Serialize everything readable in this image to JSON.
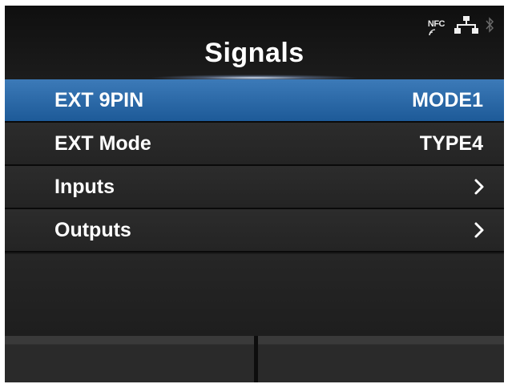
{
  "header": {
    "title": "Signals",
    "status": {
      "nfc_label": "NFC",
      "icons": [
        "nfc-icon",
        "lan-icon",
        "bluetooth-icon"
      ]
    }
  },
  "menu": {
    "items": [
      {
        "label": "EXT 9PIN",
        "value": "MODE1",
        "selected": true
      },
      {
        "label": "EXT Mode",
        "value": "TYPE4",
        "selected": false
      },
      {
        "label": "Inputs",
        "icon": "chevron-right-icon",
        "selected": false
      },
      {
        "label": "Outputs",
        "icon": "chevron-right-icon",
        "selected": false
      }
    ]
  },
  "colors": {
    "selected_row": "#2d6aa8",
    "background": "#1b1b1b",
    "text": "#ffffff"
  }
}
